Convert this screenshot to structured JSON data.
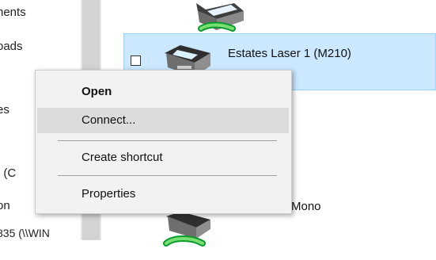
{
  "nav": {
    "items": [
      "nents",
      "oads",
      "es",
      ": (C",
      "on",
      "835 (\\\\WIN"
    ]
  },
  "content": {
    "printers": [
      {
        "name": ""
      },
      {
        "name": "Estates Laser 1 (M210)"
      },
      {
        "name": "Mono"
      },
      {
        "name": ""
      }
    ]
  },
  "context_menu": {
    "items": [
      {
        "label": "Open"
      },
      {
        "label": "Connect..."
      },
      {
        "label": "Create shortcut"
      },
      {
        "label": "Properties"
      }
    ]
  },
  "colors": {
    "selection": "#cce8ff",
    "menu_hover": "#dcdcdc",
    "menu_background": "#f2f2f2"
  }
}
